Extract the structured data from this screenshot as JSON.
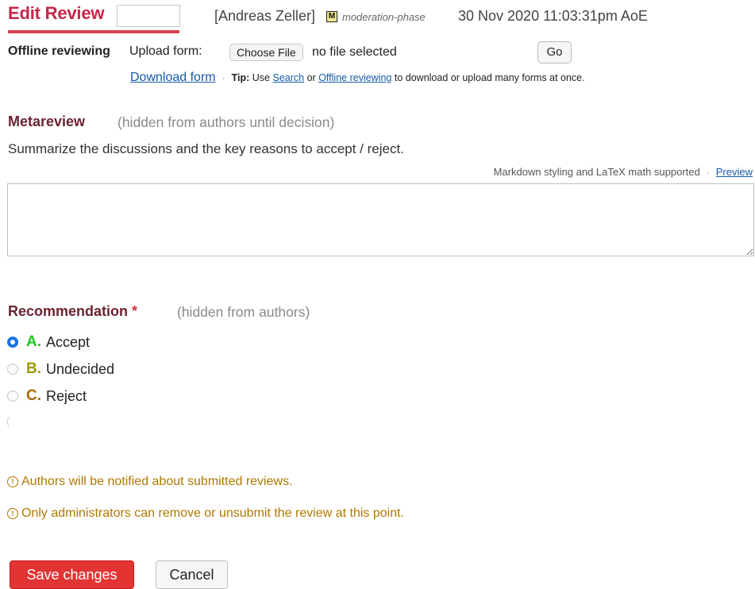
{
  "header": {
    "title": "Edit Review",
    "reviewer": "[Andreas Zeller]",
    "phase_badge": "M",
    "phase": "moderation-phase",
    "datetime": "30 Nov 2020 11:03:31pm AoE"
  },
  "offline": {
    "label": "Offline reviewing",
    "upload_label": "Upload form:",
    "choose_file": "Choose File",
    "file_status": "no file selected",
    "go": "Go",
    "download_form": "Download form",
    "tip_label": "Tip:",
    "tip_use": "Use",
    "tip_search": "Search",
    "tip_or": "or",
    "tip_offline": "Offline reviewing",
    "tip_rest": "to download or upload many forms at once."
  },
  "metareview": {
    "heading": "Metareview",
    "hint": "(hidden from authors until decision)",
    "description": "Summarize the discussions and the key reasons to accept / reject.",
    "markdown_note": "Markdown styling and LaTeX math supported",
    "preview": "Preview",
    "value": ""
  },
  "recommendation": {
    "heading": "Recommendation",
    "required": "*",
    "hint": "(hidden from authors)",
    "options": [
      {
        "letter": "A.",
        "label": "Accept",
        "checked": true
      },
      {
        "letter": "B.",
        "label": "Undecided",
        "checked": false
      },
      {
        "letter": "C.",
        "label": "Reject",
        "checked": false
      }
    ],
    "stray": "("
  },
  "warnings": {
    "icon": "!",
    "notify": "Authors will be notified about submitted reviews.",
    "admin_only": "Only administrators can remove or unsubmit the review at this point."
  },
  "actions": {
    "save": "Save changes",
    "cancel": "Cancel"
  },
  "colors": {
    "title": "#c7264a",
    "section_heading": "#6b2331",
    "link": "#155aa8",
    "warning": "#b07800",
    "save_button": "#e33434",
    "radio_checked": "#1a73e8"
  }
}
